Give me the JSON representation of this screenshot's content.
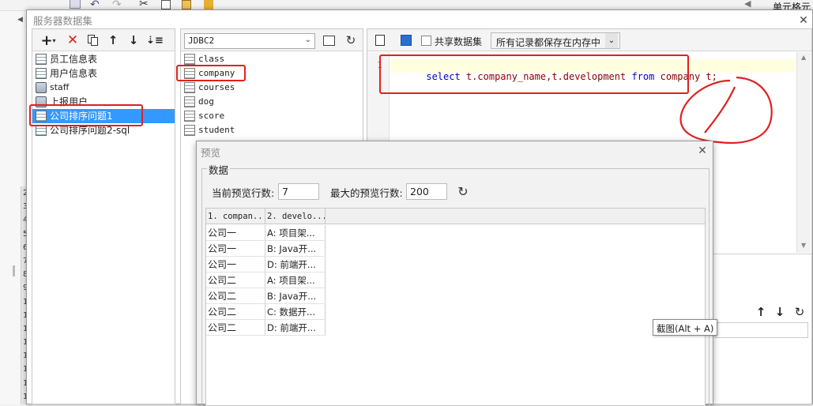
{
  "background": {
    "right_strip_label": "单元格元",
    "left_gutter_numbers": [
      "2",
      "3",
      "4",
      "5",
      "6",
      "7",
      "8",
      "9",
      "1",
      "1",
      "1",
      "1",
      "1",
      "1",
      "1",
      "1"
    ]
  },
  "dialog": {
    "title": "服务器数据集",
    "close_glyph": "✕"
  },
  "left_panel": {
    "items": [
      {
        "label": "员工信息表",
        "icon": "dataset-doc-icon"
      },
      {
        "label": "用户信息表",
        "icon": "dataset-doc-icon"
      },
      {
        "label": "staff",
        "icon": "dataset-db-icon"
      },
      {
        "label": "上报用户",
        "icon": "dataset-db-icon"
      },
      {
        "label": "公司排序问题1",
        "icon": "dataset-doc-icon",
        "selected": true
      },
      {
        "label": "公司排序问题2-sql",
        "icon": "dataset-doc-icon"
      }
    ]
  },
  "middle_panel": {
    "connection": "JDBC2",
    "tables": [
      "class",
      "company",
      "courses",
      "dog",
      "score",
      "student"
    ]
  },
  "sql_editor": {
    "toolbar": {
      "share_label": "共享数据集",
      "mode_value": "所有记录都保存在内存中"
    },
    "line_number": "1",
    "sql": {
      "kw_select": "select",
      "fields": " t.company_name,t.development ",
      "kw_from": "from",
      "rest": " company t;"
    }
  },
  "preview": {
    "title": "预览",
    "group_label": "数据",
    "current_rows_label": "当前预览行数:",
    "current_rows_value": "7",
    "max_rows_label": "最大的预览行数:",
    "max_rows_value": "200",
    "columns": [
      "1. compan...",
      "2. develo..."
    ],
    "rows": [
      [
        "公司一",
        "A: 项目架..."
      ],
      [
        "公司一",
        "B: Java开..."
      ],
      [
        "公司一",
        "D: 前端开..."
      ],
      [
        "公司二",
        "A: 项目架..."
      ],
      [
        "公司二",
        "B: Java开..."
      ],
      [
        "公司二",
        "C: 数据开..."
      ],
      [
        "公司二",
        "D: 前端开..."
      ]
    ]
  },
  "tooltip": {
    "text": "截图(Alt + A)"
  },
  "colors": {
    "selection": "#3399ff",
    "annotation_red": "#e02020",
    "sql_keyword": "#0000c8",
    "sql_text": "#8b0000",
    "sql_line_highlight": "#ffffe0"
  }
}
